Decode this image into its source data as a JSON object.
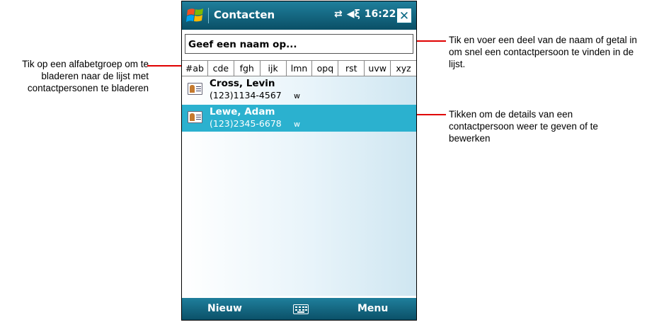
{
  "callouts": {
    "left": "Tik op een alfabetgroep om te bladeren naar de lijst met contactpersonen te bladeren",
    "right_search": "Tik en voer een deel van de naam of getal in om snel een contactpersoon te vinden in de lijst.",
    "right_details": "Tikken om de details van een contactpersoon weer te geven of te bewerken",
    "leader_color": "#e00000"
  },
  "titlebar": {
    "title": "Contacten",
    "time": "16:22",
    "close": "✕"
  },
  "search": {
    "placeholder": "Geef een naam op..."
  },
  "alpha_tabs": [
    "#ab",
    "cde",
    "fgh",
    "ijk",
    "lmn",
    "opq",
    "rst",
    "uvw",
    "xyz"
  ],
  "contacts": [
    {
      "name": "Cross, Levin",
      "phone": "(123)1134-4567",
      "type": "w",
      "selected": false
    },
    {
      "name": "Lewe, Adam",
      "phone": "(123)2345-6678",
      "type": "w",
      "selected": true
    }
  ],
  "softkeys": {
    "left": "Nieuw",
    "right": "Menu"
  },
  "colors": {
    "bar": "#0d6a85",
    "selected_row": "#2bb1cf"
  }
}
